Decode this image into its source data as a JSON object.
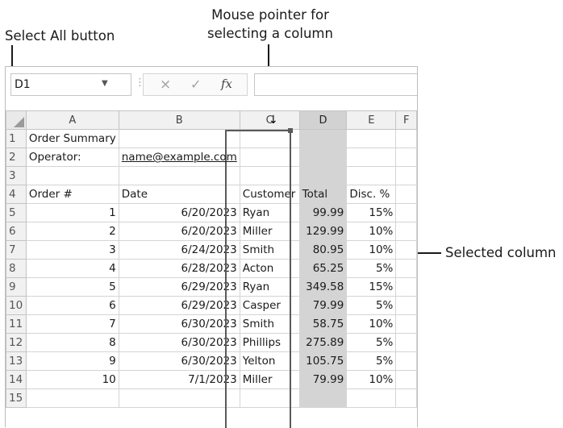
{
  "callouts": {
    "select_all": "Select All button",
    "pointer_line1": "Mouse pointer for",
    "pointer_line2": "selecting a column",
    "selected_column": "Selected column"
  },
  "formula_bar": {
    "name_box": "D1",
    "cancel_icon": "×",
    "enter_icon": "✓",
    "fx_icon": "fx",
    "formula_value": ""
  },
  "columns": [
    "A",
    "B",
    "C",
    "D",
    "E",
    "F"
  ],
  "selected_column": "D",
  "pointer_glyph": "↓",
  "rows": [
    {
      "n": "1",
      "A": "Order Summary",
      "B": "",
      "C": "",
      "D": "",
      "E": "",
      "F": ""
    },
    {
      "n": "2",
      "A": "Operator:",
      "B": "name@example.com",
      "C": "",
      "D": "",
      "E": "",
      "F": ""
    },
    {
      "n": "3",
      "A": "",
      "B": "",
      "C": "",
      "D": "",
      "E": "",
      "F": ""
    },
    {
      "n": "4",
      "A": "Order #",
      "B": "Date",
      "C": "Customer",
      "D": "Total",
      "E": "Disc. %",
      "F": ""
    },
    {
      "n": "5",
      "A": "1",
      "B": "6/20/2023",
      "C": "Ryan",
      "D": "99.99",
      "E": "15%",
      "F": ""
    },
    {
      "n": "6",
      "A": "2",
      "B": "6/20/2023",
      "C": "Miller",
      "D": "129.99",
      "E": "10%",
      "F": ""
    },
    {
      "n": "7",
      "A": "3",
      "B": "6/24/2023",
      "C": "Smith",
      "D": "80.95",
      "E": "10%",
      "F": ""
    },
    {
      "n": "8",
      "A": "4",
      "B": "6/28/2023",
      "C": "Acton",
      "D": "65.25",
      "E": "5%",
      "F": ""
    },
    {
      "n": "9",
      "A": "5",
      "B": "6/29/2023",
      "C": "Ryan",
      "D": "349.58",
      "E": "15%",
      "F": ""
    },
    {
      "n": "10",
      "A": "6",
      "B": "6/29/2023",
      "C": "Casper",
      "D": "79.99",
      "E": "5%",
      "F": ""
    },
    {
      "n": "11",
      "A": "7",
      "B": "6/30/2023",
      "C": "Smith",
      "D": "58.75",
      "E": "10%",
      "F": ""
    },
    {
      "n": "12",
      "A": "8",
      "B": "6/30/2023",
      "C": "Phillips",
      "D": "275.89",
      "E": "5%",
      "F": ""
    },
    {
      "n": "13",
      "A": "9",
      "B": "6/30/2023",
      "C": "Yelton",
      "D": "105.75",
      "E": "5%",
      "F": ""
    },
    {
      "n": "14",
      "A": "10",
      "B": "7/1/2023",
      "C": "Miller",
      "D": "79.99",
      "E": "10%",
      "F": ""
    },
    {
      "n": "15",
      "A": "",
      "B": "",
      "C": "",
      "D": "",
      "E": "",
      "F": ""
    }
  ],
  "colors": {
    "selection_fill": "#d4d4d4",
    "selection_border": "#5a5a5a",
    "header_fill": "#f1f1f1",
    "gridline": "#d4d4d4"
  }
}
